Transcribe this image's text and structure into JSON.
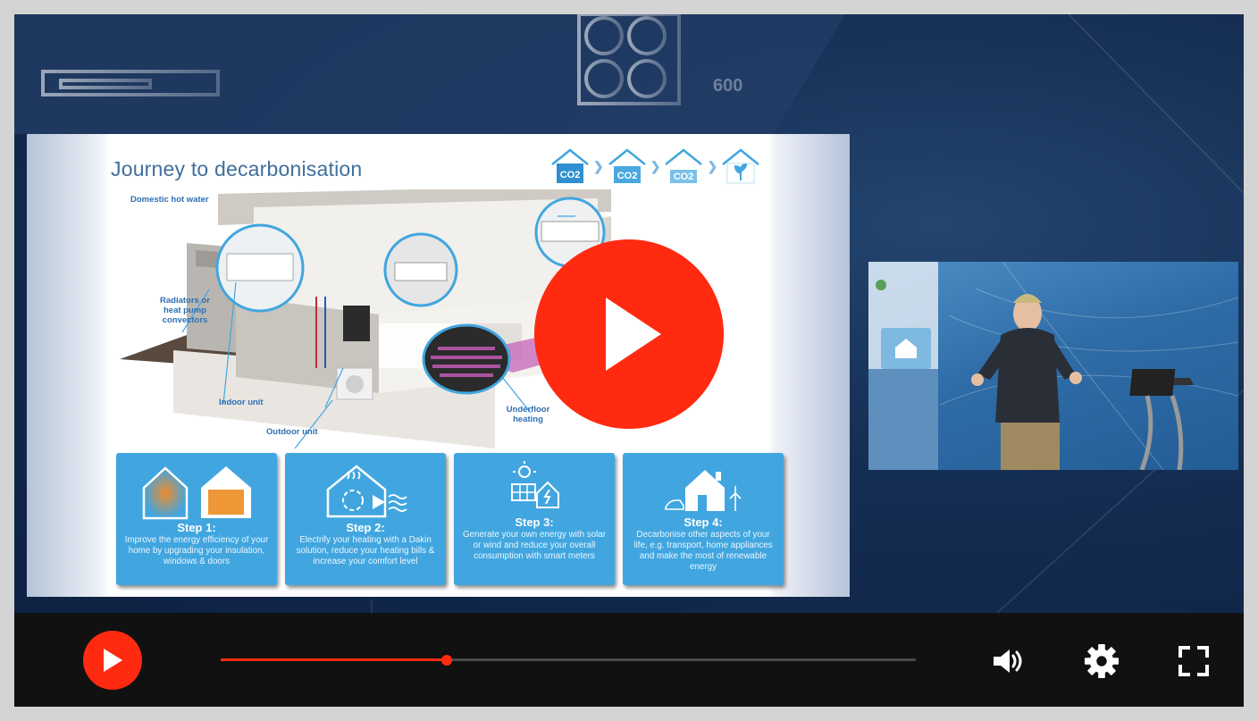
{
  "player": {
    "progress": 0.325,
    "accent_color": "#ff2a0f",
    "controls": {
      "play_icon": "play-icon",
      "volume_icon": "volume-icon",
      "settings_icon": "gear-icon",
      "fullscreen_icon": "fullscreen-icon"
    }
  },
  "background": {
    "blueprint_label": "600"
  },
  "slide": {
    "title": "Journey to decarbonisation",
    "co2_houses": [
      "CO2",
      "CO2",
      "CO2"
    ],
    "callouts": {
      "hot_water": "Domestic hot water",
      "radiators": "Radiators or heat pump convectors",
      "indoor": "Indoor unit",
      "outdoor": "Outdoor unit",
      "underfloor": "Underfloor heating"
    },
    "steps": [
      {
        "title": "Step 1:",
        "text": "Improve the energy efficiency of your home by upgrading your insulation, windows & doors"
      },
      {
        "title": "Step 2:",
        "text": "Electrify your heating with a Dakin solution, reduce your heating bills & increase your comfort level"
      },
      {
        "title": "Step 3:",
        "text": "Generate your own energy with solar or wind and reduce your overall consumption with smart meters"
      },
      {
        "title": "Step 4:",
        "text": "Decarbonise other aspects of your life, e.g. transport, home appliances and make the most of renewable energy"
      }
    ]
  }
}
